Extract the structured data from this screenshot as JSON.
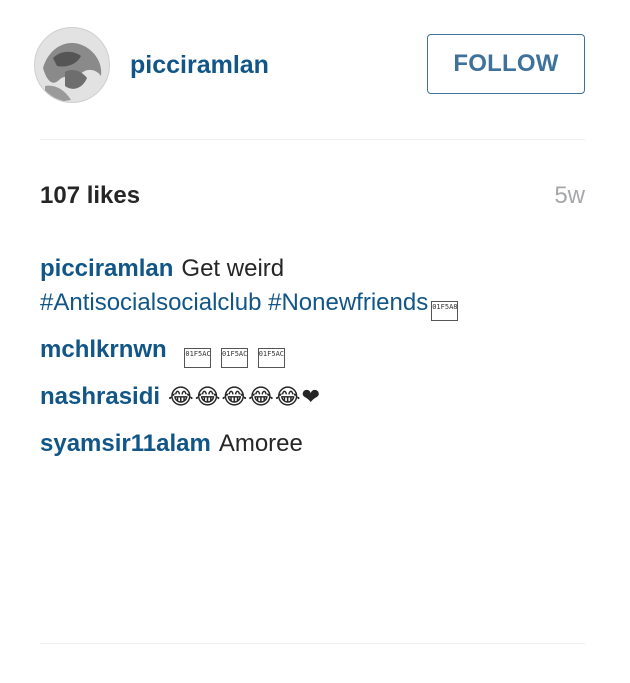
{
  "post_header": {
    "username": "picciramlan",
    "follow_label": "FOLLOW"
  },
  "stats": {
    "likes_text": "107 likes",
    "age": "5w"
  },
  "comments": [
    {
      "user": "picciramlan",
      "text": "Get weird",
      "hashtags": [
        "#Antisocialsocialclub",
        "#Nonewfriends"
      ],
      "trailing_glyph": "01F5A8"
    },
    {
      "user": "mchlkrnwn",
      "text": "",
      "glyphs": [
        "01F5AC",
        "01F5AC",
        "01F5AC"
      ]
    },
    {
      "user": "nashrasidi",
      "text": "😂😂😂😂😂❤"
    },
    {
      "user": "syamsir11alam",
      "text": "Amoree"
    }
  ],
  "colors": {
    "username": "#125688",
    "follow_border": "#3f729b",
    "muted": "#a5a7aa",
    "divider": "#efefef"
  },
  "icons": {
    "avatar": "profile-photo-grayscale"
  }
}
